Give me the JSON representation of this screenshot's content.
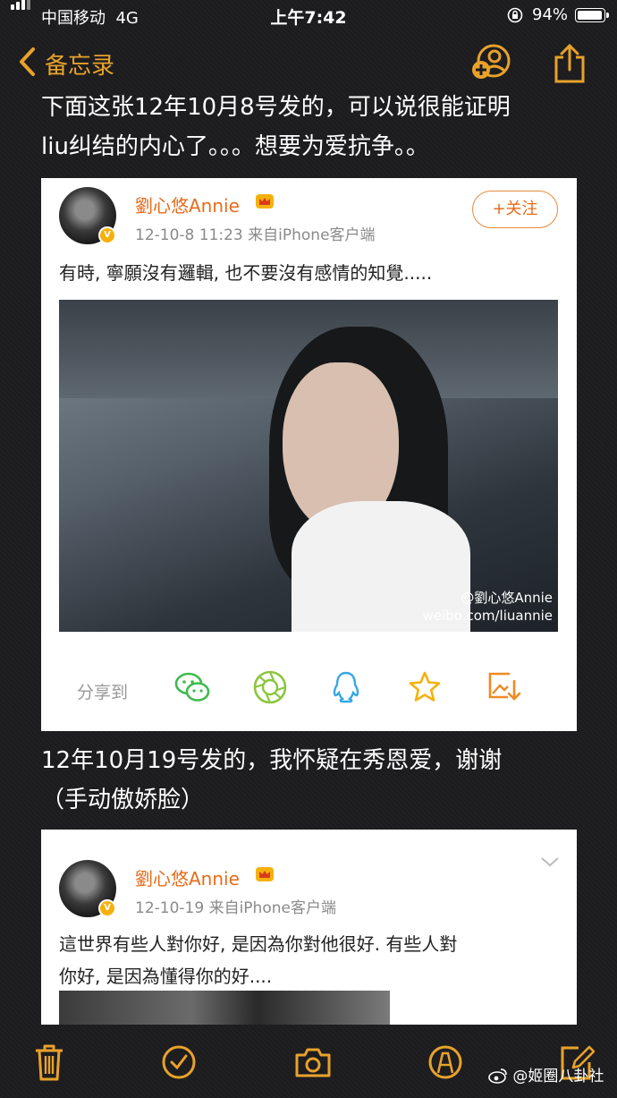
{
  "status_bar": {
    "carrier": "中国移动",
    "network": "4G",
    "time": "上午7:42",
    "battery_pct": "94%"
  },
  "nav": {
    "back_label": "备忘录"
  },
  "note": {
    "para1": [
      "下面这张12年10月8号发的，可以说很能证明",
      "liu纠结的内心了。。。想要为爱抗争。。"
    ],
    "para2": [
      "12年10月19号发的，我怀疑在秀恩爱，谢谢",
      "（手动傲娇脸）"
    ]
  },
  "post1": {
    "author": "劉心悠Annie",
    "meta": "12-10-8 11:23  来自iPhone客户端",
    "follow_label": "+关注",
    "text": "有時, 寧願沒有邏輯, 也不要沒有感情的知覺.....",
    "watermark_handle": "@劉心悠Annie",
    "watermark_url": "weibo.com/liuannie",
    "share_label": "分享到",
    "share_icons": [
      "wechat-icon",
      "moments-icon",
      "qq-icon",
      "favorite-star-icon",
      "save-image-icon"
    ]
  },
  "post2": {
    "author": "劉心悠Annie",
    "meta": "12-10-19  来自iPhone客户端",
    "text": [
      "這世界有些人對你好, 是因為你對他很好. 有些人對",
      "你好, 是因為懂得你的好...."
    ]
  },
  "watermark": "@姬圈八卦社",
  "colors": {
    "accent": "#e8a22b",
    "weibo_orange": "#e86b1a",
    "background": "#1c1c1e"
  }
}
